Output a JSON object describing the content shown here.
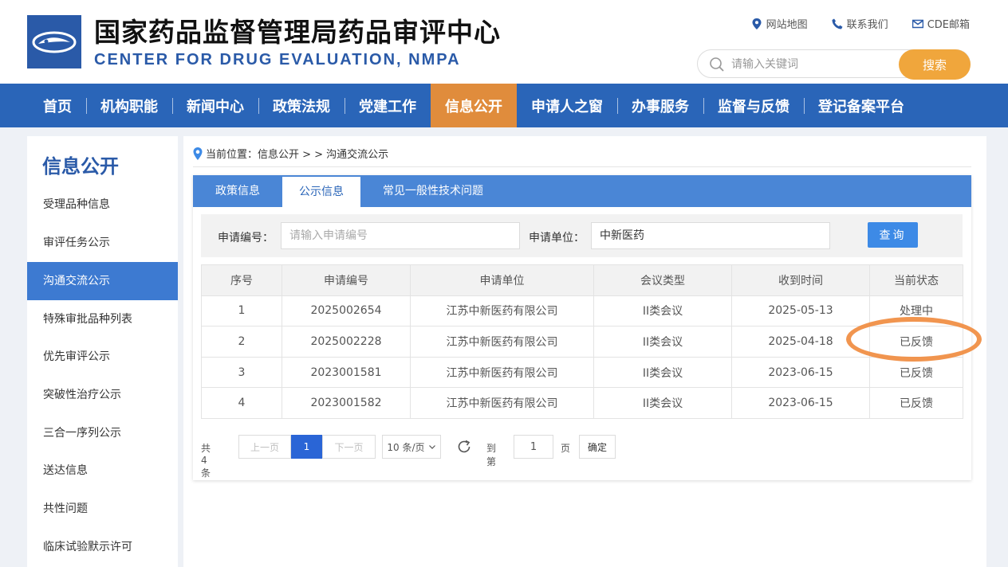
{
  "header": {
    "title": "国家药品监督管理局药品审评中心",
    "subtitle": "CENTER FOR DRUG EVALUATION, NMPA",
    "links": [
      {
        "label": "网站地图",
        "icon": "location-pin-icon"
      },
      {
        "label": "联系我们",
        "icon": "phone-icon"
      },
      {
        "label": "CDE邮箱",
        "icon": "mail-icon"
      }
    ],
    "search_placeholder": "请输入关键词",
    "search_button": "搜索"
  },
  "nav": [
    {
      "label": "首页"
    },
    {
      "label": "机构职能"
    },
    {
      "label": "新闻中心"
    },
    {
      "label": "政策法规"
    },
    {
      "label": "党建工作"
    },
    {
      "label": "信息公开",
      "active": true
    },
    {
      "label": "申请人之窗"
    },
    {
      "label": "办事服务"
    },
    {
      "label": "监督与反馈"
    },
    {
      "label": "登记备案平台"
    }
  ],
  "sidebar": {
    "title": "信息公开",
    "items": [
      {
        "label": "受理品种信息"
      },
      {
        "label": "审评任务公示"
      },
      {
        "label": "沟通交流公示",
        "active": true
      },
      {
        "label": "特殊审批品种列表"
      },
      {
        "label": "优先审评公示"
      },
      {
        "label": "突破性治疗公示"
      },
      {
        "label": "三合一序列公示"
      },
      {
        "label": "送达信息"
      },
      {
        "label": "共性问题"
      },
      {
        "label": "临床试验默示许可"
      }
    ]
  },
  "breadcrumb": {
    "text": "当前位置：信息公开 > > 沟通交流公示"
  },
  "tabs": [
    {
      "label": "政策信息"
    },
    {
      "label": "公示信息",
      "active": true
    },
    {
      "label": "常见一般性技术问题"
    }
  ],
  "filter": {
    "app_no_label": "申请编号：",
    "app_no_placeholder": "请输入申请编号",
    "unit_label": "申请单位：",
    "unit_value": "中新医药",
    "query_button": "查询"
  },
  "table": {
    "headers": [
      "序号",
      "申请编号",
      "申请单位",
      "会议类型",
      "收到时间",
      "当前状态"
    ],
    "rows": [
      [
        "1",
        "2025002654",
        "江苏中新医药有限公司",
        "II类会议",
        "2025-05-13",
        "处理中"
      ],
      [
        "2",
        "2025002228",
        "江苏中新医药有限公司",
        "II类会议",
        "2025-04-18",
        "已反馈"
      ],
      [
        "3",
        "2023001581",
        "江苏中新医药有限公司",
        "II类会议",
        "2023-06-15",
        "已反馈"
      ],
      [
        "4",
        "2023001582",
        "江苏中新医药有限公司",
        "II类会议",
        "2023-06-15",
        "已反馈"
      ]
    ]
  },
  "pager": {
    "total": "共 4 条",
    "prev": "上一页",
    "current": "1",
    "next": "下一页",
    "page_size": "10 条/页",
    "goto_label": "到第",
    "goto_value": "1",
    "page_unit": "页",
    "confirm": "确定"
  },
  "colors": {
    "brand_blue": "#2a65b8",
    "active_orange": "#e08c3c",
    "search_orange": "#f0a63c",
    "annotation_orange": "#f08a3c"
  }
}
